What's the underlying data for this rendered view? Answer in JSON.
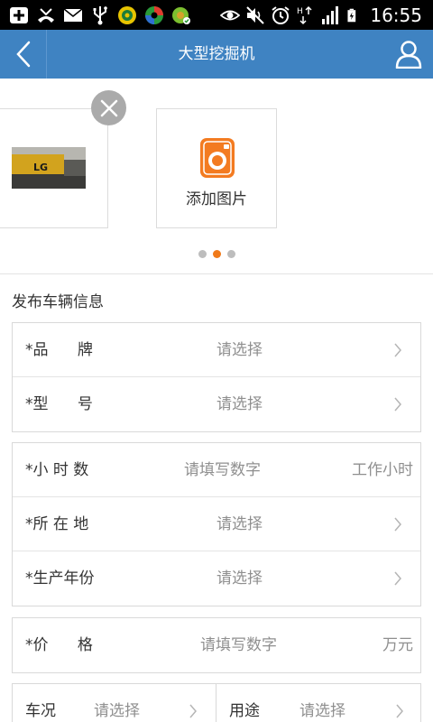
{
  "status_bar": {
    "time": "16:55",
    "icons": [
      "add-icon",
      "missed-call-icon",
      "mail-icon",
      "usb-icon",
      "app-icon",
      "app-icon",
      "app-icon",
      "eye-icon",
      "mute-icon",
      "alarm-icon",
      "data-arrows-icon",
      "signal-icon",
      "battery-charging-icon"
    ]
  },
  "navbar": {
    "title": "大型挖掘机",
    "back_icon": "chevron-left-icon",
    "user_icon": "user-icon",
    "bg_color": "#3f83c2"
  },
  "carousel": {
    "add_label": "添加图片",
    "photo_thumb_text": "LG",
    "dots": 3,
    "active_dot": 1,
    "accent_color": "#f07a1a"
  },
  "section": {
    "title": "发布车辆信息"
  },
  "group1": [
    {
      "label": "*品      牌",
      "value": "请选择"
    },
    {
      "label": "*型      号",
      "value": "请选择"
    }
  ],
  "group2": [
    {
      "label": "*小 时 数",
      "value": "请填写数字",
      "unit": "工作小时"
    },
    {
      "label": "*所 在 地",
      "value": "请选择"
    },
    {
      "label": "*生产年份",
      "value": "请选择"
    }
  ],
  "group3": [
    {
      "label": "*价      格",
      "value": "请填写数字",
      "unit": "万元"
    }
  ],
  "group4": [
    {
      "label": "车况",
      "value": "请选择"
    },
    {
      "label": "用途",
      "value": "请选择"
    }
  ]
}
